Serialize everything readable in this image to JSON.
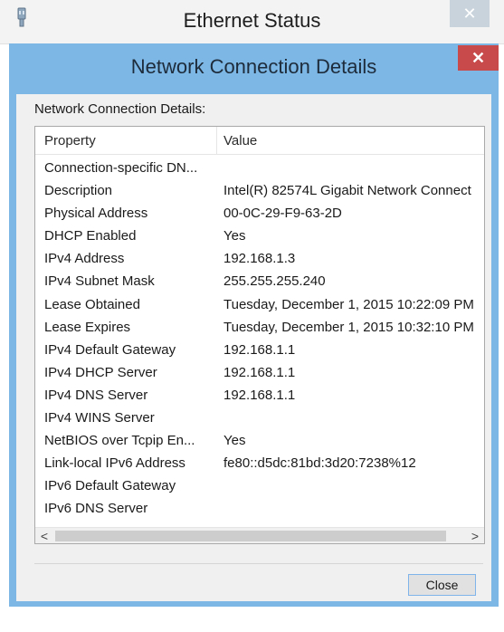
{
  "background_window": {
    "title": "Ethernet Status",
    "close_glyph": "✕",
    "app_icon": "network-adapter-icon"
  },
  "dialog": {
    "title": "Network Connection Details",
    "close_glyph": "✕",
    "group_label": "Network Connection Details:",
    "columns": [
      "Property",
      "Value"
    ],
    "rows": [
      {
        "property": "Connection-specific DN...",
        "value": ""
      },
      {
        "property": "Description",
        "value": "Intel(R) 82574L Gigabit Network Connect"
      },
      {
        "property": "Physical Address",
        "value": "00-0C-29-F9-63-2D"
      },
      {
        "property": "DHCP Enabled",
        "value": "Yes"
      },
      {
        "property": "IPv4 Address",
        "value": "192.168.1.3"
      },
      {
        "property": "IPv4 Subnet Mask",
        "value": "255.255.255.240"
      },
      {
        "property": "Lease Obtained",
        "value": "Tuesday, December 1, 2015 10:22:09 PM"
      },
      {
        "property": "Lease Expires",
        "value": "Tuesday, December 1, 2015 10:32:10 PM"
      },
      {
        "property": "IPv4 Default Gateway",
        "value": "192.168.1.1"
      },
      {
        "property": "IPv4 DHCP Server",
        "value": "192.168.1.1"
      },
      {
        "property": "IPv4 DNS Server",
        "value": "192.168.1.1"
      },
      {
        "property": "IPv4 WINS Server",
        "value": ""
      },
      {
        "property": "NetBIOS over Tcpip En...",
        "value": "Yes"
      },
      {
        "property": "Link-local IPv6 Address",
        "value": "fe80::d5dc:81bd:3d20:7238%12"
      },
      {
        "property": "IPv6 Default Gateway",
        "value": ""
      },
      {
        "property": "IPv6 DNS Server",
        "value": ""
      }
    ],
    "scroll_left_glyph": "<",
    "scroll_right_glyph": ">",
    "close_button_label": "Close"
  },
  "colors": {
    "dialog_frame": "#7cb7e5",
    "close_red": "#c84a4a",
    "button_focus_border": "#7eb4ea"
  }
}
